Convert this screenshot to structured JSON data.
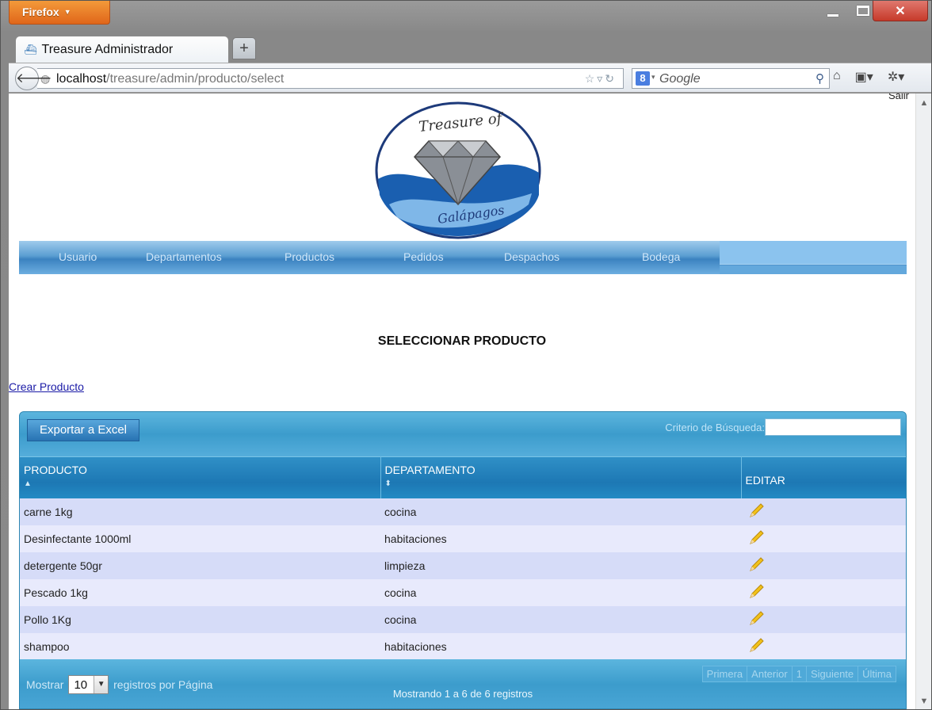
{
  "browser": {
    "app_button": "Firefox",
    "tab_title": "Treasure Administrador",
    "new_tab": "+",
    "url_host": "localhost",
    "url_path": "/treasure/admin/producto/select",
    "search_engine_placeholder": "Google",
    "window_controls": [
      "minimize-icon",
      "maximize-icon",
      "close-icon"
    ]
  },
  "header": {
    "salir": "Salir",
    "logo_top_text": "Treasure of",
    "logo_bottom_text": "Galápagos"
  },
  "menu": {
    "items": [
      "Usuario",
      "Departamentos",
      "Productos",
      "Pedidos",
      "Despachos",
      "Bodega"
    ]
  },
  "page": {
    "title": "SELECCIONAR PRODUCTO",
    "create_link": "Crear Producto"
  },
  "table": {
    "export_button": "Exportar a Excel",
    "search_label": "Criterio de Búsqueda:",
    "search_value": "",
    "columns": [
      "PRODUCTO",
      "DEPARTAMENTO",
      "EDITAR"
    ],
    "rows": [
      {
        "producto": "carne 1kg",
        "departamento": "cocina"
      },
      {
        "producto": "Desinfectante 1000ml",
        "departamento": "habitaciones"
      },
      {
        "producto": "detergente 50gr",
        "departamento": "limpieza"
      },
      {
        "producto": "Pescado 1kg",
        "departamento": "cocina"
      },
      {
        "producto": "Pollo 1Kg",
        "departamento": "cocina"
      },
      {
        "producto": "shampoo",
        "departamento": "habitaciones"
      }
    ],
    "edit_icon": "pencil-icon"
  },
  "footer": {
    "show_prefix": "Mostrar",
    "page_size": "10",
    "show_suffix": "registros por Página",
    "showing": "Mostrando 1 a 6 de 6 registros",
    "pager": [
      "Primera",
      "Anterior",
      "1",
      "Siguiente",
      "Última"
    ]
  },
  "colors": {
    "menu_blue": "#3b82c0",
    "table_header": "#1d78b4",
    "row_odd": "#d6dcf8",
    "row_even": "#e8eafc",
    "firefox_orange": "#e0661a",
    "close_red": "#c63a2a"
  }
}
